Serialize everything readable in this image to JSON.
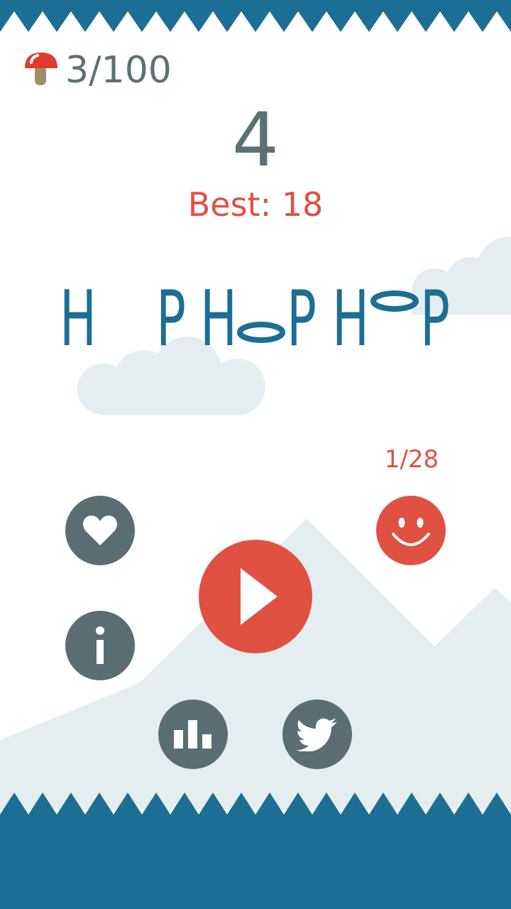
{
  "hud": {
    "mushroom_icon": "mushroom-icon",
    "mushrooms_collected": "3",
    "mushrooms_separator": "/",
    "mushrooms_total": "100",
    "score": "4",
    "best_label": "Best:",
    "best_value": "18"
  },
  "title": {
    "letters": [
      "H",
      "P",
      "H",
      "P",
      "H",
      "P"
    ]
  },
  "unlocks": {
    "progress": "1/28",
    "character_icon": "smiley-face-icon"
  },
  "buttons": {
    "like": "heart-icon",
    "info": "info-icon",
    "play": "play-icon",
    "leaderboard": "bar-chart-icon",
    "share": "twitter-bird-icon"
  },
  "colors": {
    "primary_blue": "#1c6e94",
    "button_gray": "#596d72",
    "accent_red": "#e05142",
    "text_gray": "#5d7175",
    "scenery": "#e4eef1"
  }
}
